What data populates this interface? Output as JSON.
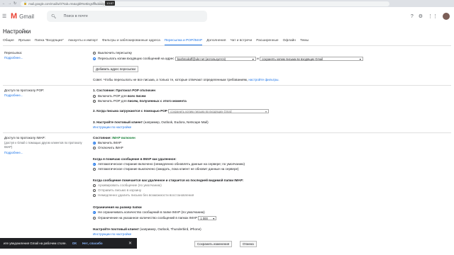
{
  "browser": {
    "url": "mail.google.com/mail/u/0/?tab=rm&ogbl#settings/fwdandpop",
    "nav_back": "←",
    "nav_forward": "→",
    "nav_reload": "↻",
    "clock": "13:57"
  },
  "header": {
    "app_name": "Gmail",
    "logo_letter": "M",
    "search_placeholder": "Поиск в почте"
  },
  "page_title": "Настройки",
  "tabs": [
    "Общие",
    "Ярлыки",
    "Папка \"Входящие\"",
    "Аккаунты и импорт",
    "Фильтры и заблокированные адреса",
    "Пересылка и POP/IMAP",
    "Дополнения",
    "Чат и встречи",
    "Расширенные",
    "Офлайн",
    "Темы"
  ],
  "active_tab": "Пересылка и POP/IMAP",
  "forwarding": {
    "label": "Пересылка:",
    "more": "Подробнее...",
    "opt_off": "Выключить пересылку",
    "opt_on": "Пересылать копии входящих сообщений на адрес",
    "address": "bashmakoff@ukr.net (используется)",
    "and": "и",
    "keep": "сохранять копию письма во входящих Gmail",
    "add_button": "Добавить адрес пересылки",
    "tip_text": "Совет. Чтобы пересылать не все письма, а только те, которые отвечают определенным требованиям,",
    "tip_link": "настройте фильтры."
  },
  "pop": {
    "label": "Доступ по протоколу POP:",
    "more": "Подробнее...",
    "s1_title": "1. Состояние: Протокол POP отключен",
    "s1_opt1_a": "Включить POP для",
    "s1_opt1_b": "всех писем",
    "s1_opt2_a": "Включить POP для",
    "s1_opt2_b": "писем, полученных с этого момента",
    "s2_title": "2. Когда письма загружаются с помощью POP",
    "s2_select": "сохранить копию письма во входящих Gmail",
    "s3_title": "3. Настройте почтовый клиент",
    "s3_note": "(например, Outlook, Eudora, Netscape Mail)",
    "s3_link": "Инструкции по настройке"
  },
  "imap": {
    "label": "Доступ по протоколу IMAP:",
    "note": "(доступ к Gmail с помощью других клиентов по протоколу IMAP)",
    "more": "Подробнее...",
    "status_prefix": "Состояние:",
    "status": "IMAP включен",
    "opt_on": "Включить IMAP",
    "opt_off": "Отключить IMAP",
    "delete_title": "Когда я помечаю сообщение в IMAP как удаленное:",
    "delete_opt1": "Автоматическое стирание включено (немедленно обновлять данные на сервере; по умолчанию)",
    "delete_opt2": "Автоматическое стирание выключено (ожидать, пока клиент не обновит данные на сервере)",
    "expunge_title": "Когда сообщение помечается как удаленное и стирается из последней видимой папки IMAP:",
    "expunge_opt1": "Архивировать сообщение (по умолчанию)",
    "expunge_opt2": "Отправить письмо в корзину",
    "expunge_opt3": "Немедленно удалить письмо без возможности восстановления",
    "limit_title": "Ограничения на размер папки",
    "limit_opt1": "Не ограничивать количество сообщений в папке IMAP (по умолчанию)",
    "limit_opt2": "Ограничение на указанное количество сообщений в папках IMAP",
    "limit_value": "1 000",
    "client_title": "Настройте почтовый клиент",
    "client_note": "(например, Outlook, Thunderbird, iPhone)",
    "client_link": "Инструкции по настройке"
  },
  "footer": {
    "save": "Сохранить изменения",
    "cancel": "Отмена"
  },
  "toast": {
    "text": "ите уведомления Gmail на рабочем столе.",
    "ok": "ОК",
    "no": "Нет, спасибо"
  },
  "colors": {
    "accent": "#1a73e8",
    "status_green": "#188038",
    "gmail_red": "#ea4335"
  }
}
